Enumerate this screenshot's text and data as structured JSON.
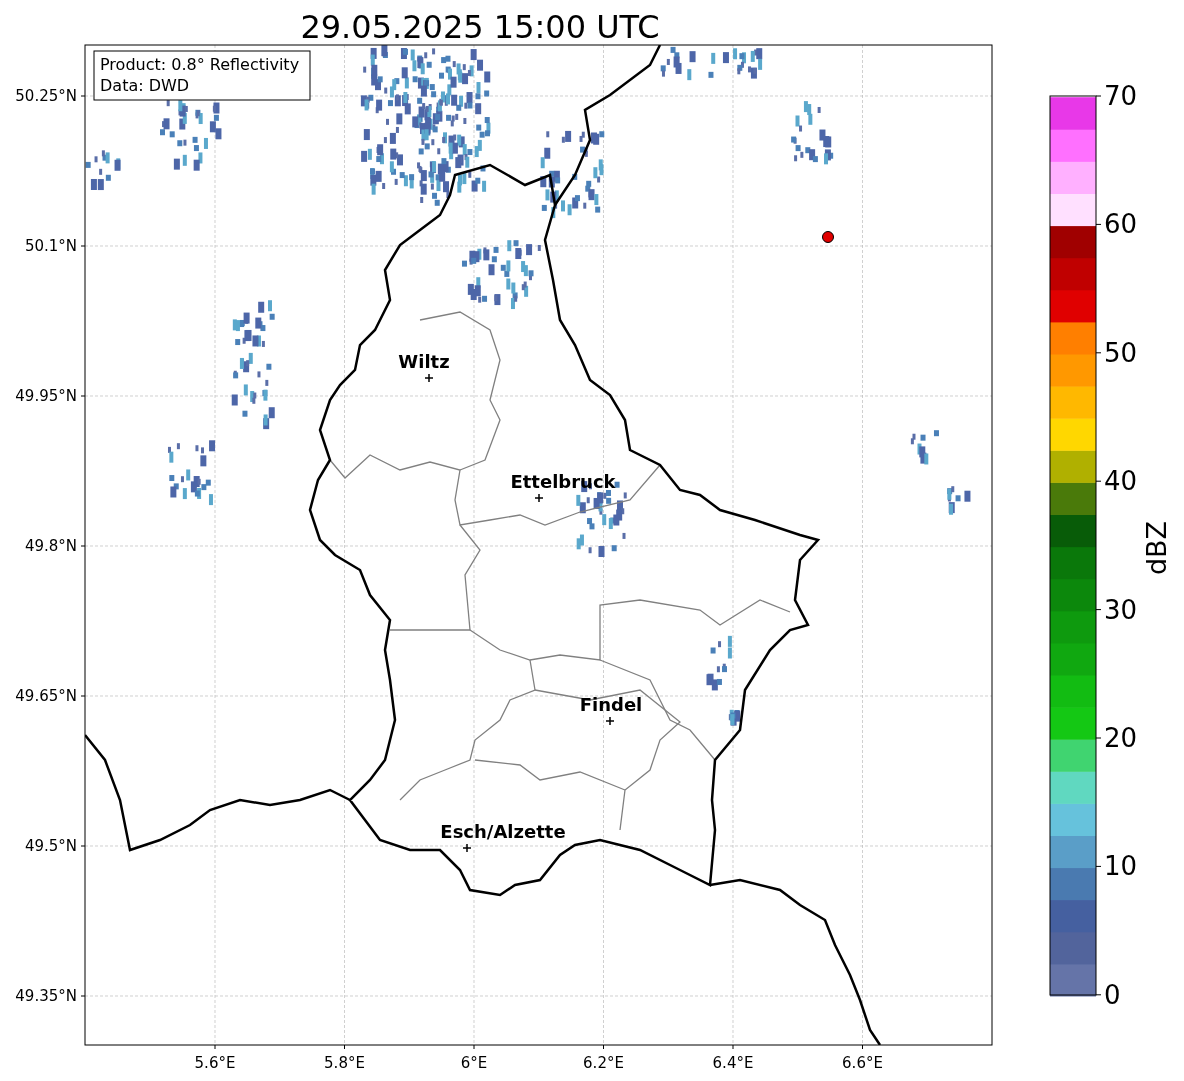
{
  "title": "29.05.2025 15:00 UTC",
  "info_box": [
    "Product: 0.8° Reflectivity",
    "Data: DWD"
  ],
  "map": {
    "lat_ticks": [
      "50.25°N",
      "50.1°N",
      "49.95°N",
      "49.8°N",
      "49.65°N",
      "49.5°N",
      "49.35°N"
    ],
    "lon_ticks": [
      "5.6°E",
      "5.8°E",
      "6°E",
      "6.2°E",
      "6.4°E",
      "6.6°E"
    ],
    "cities": [
      "Wiltz",
      "Ettelbruck",
      "Findel",
      "Esch/Alzette"
    ]
  },
  "colorbar": {
    "label": "dBZ",
    "ticks": [
      "70",
      "60",
      "50",
      "40",
      "30",
      "20",
      "10",
      "0"
    ]
  }
}
